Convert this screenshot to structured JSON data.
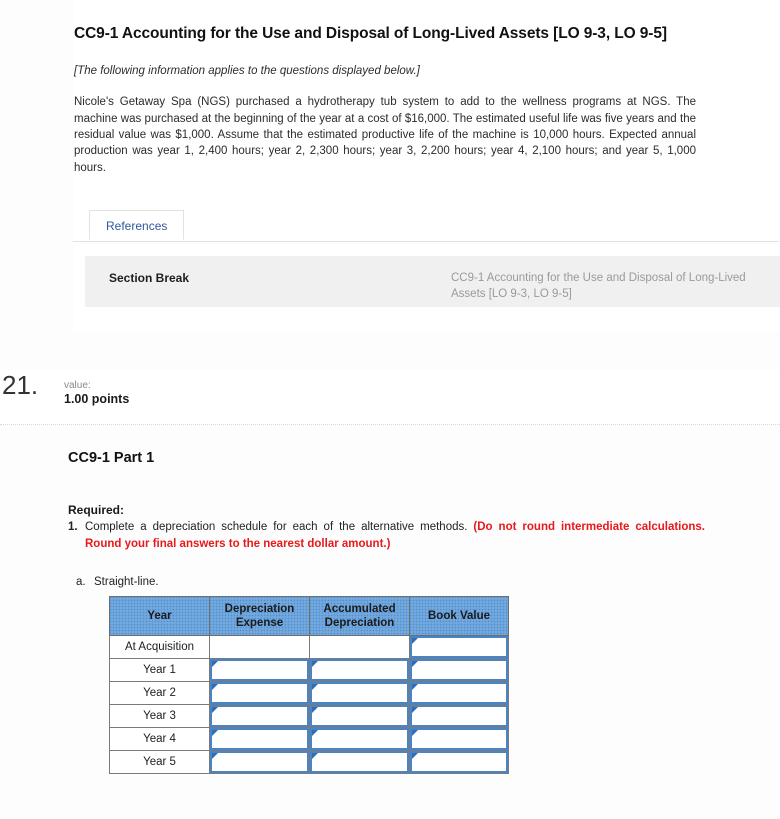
{
  "question_header": {
    "title": "CC9-1 Accounting for the Use and Disposal of Long-Lived Assets [LO 9-3, LO 9-5]",
    "applies_note": "[The following information applies to the questions displayed below.]",
    "scenario": "Nicole's Getaway Spa (NGS) purchased a hydrotherapy tub system to add to the wellness programs at NGS. The machine was purchased at the beginning of the year at a cost of $16,000. The estimated useful life was five years and the residual value was $1,000. Assume that the estimated productive life of the machine is 10,000 hours. Expected annual production was year 1, 2,400 hours; year 2, 2,300 hours; year 3, 2,200 hours; year 4, 2,100 hours; and year 5, 1,000 hours."
  },
  "tabs": [
    {
      "label": "References",
      "active": true
    }
  ],
  "section_break": {
    "label": "Section Break",
    "reference": "CC9-1 Accounting for the Use and Disposal of Long-Lived Assets [LO 9-3, LO 9-5]"
  },
  "points_bar": {
    "number": "21.",
    "value_label": "value:",
    "points": "1.00 points"
  },
  "question": {
    "part_title": "CC9-1 Part 1",
    "required_label": "Required:",
    "item_number": "1.",
    "item_text": "Complete a depreciation schedule for each of the alternative methods.",
    "item_emphasis": "(Do not round intermediate calculations. Round your final answers to the nearest dollar amount.)",
    "sub_letter": "a.",
    "sub_text": "Straight-line."
  },
  "schedule_table": {
    "columns": [
      "Year",
      "Depreciation Expense",
      "Accumulated Depreciation",
      "Book Value"
    ],
    "rows": [
      {
        "label": "At Acquisition",
        "cells": [
          "blank",
          "blank",
          "input"
        ]
      },
      {
        "label": "Year 1",
        "cells": [
          "input",
          "input",
          "input"
        ]
      },
      {
        "label": "Year 2",
        "cells": [
          "input",
          "input",
          "input"
        ]
      },
      {
        "label": "Year 3",
        "cells": [
          "input",
          "input",
          "input"
        ]
      },
      {
        "label": "Year 4",
        "cells": [
          "input",
          "input",
          "input"
        ]
      },
      {
        "label": "Year 5",
        "cells": [
          "input",
          "input",
          "input"
        ]
      }
    ],
    "input_value": ""
  },
  "colors": {
    "header_blue": "#6aa2dc",
    "input_border_blue": "#4a84c4",
    "emphasis_red": "#e8191b",
    "tab_link_blue": "#31589a",
    "section_break_bg": "#f0f0f0"
  }
}
